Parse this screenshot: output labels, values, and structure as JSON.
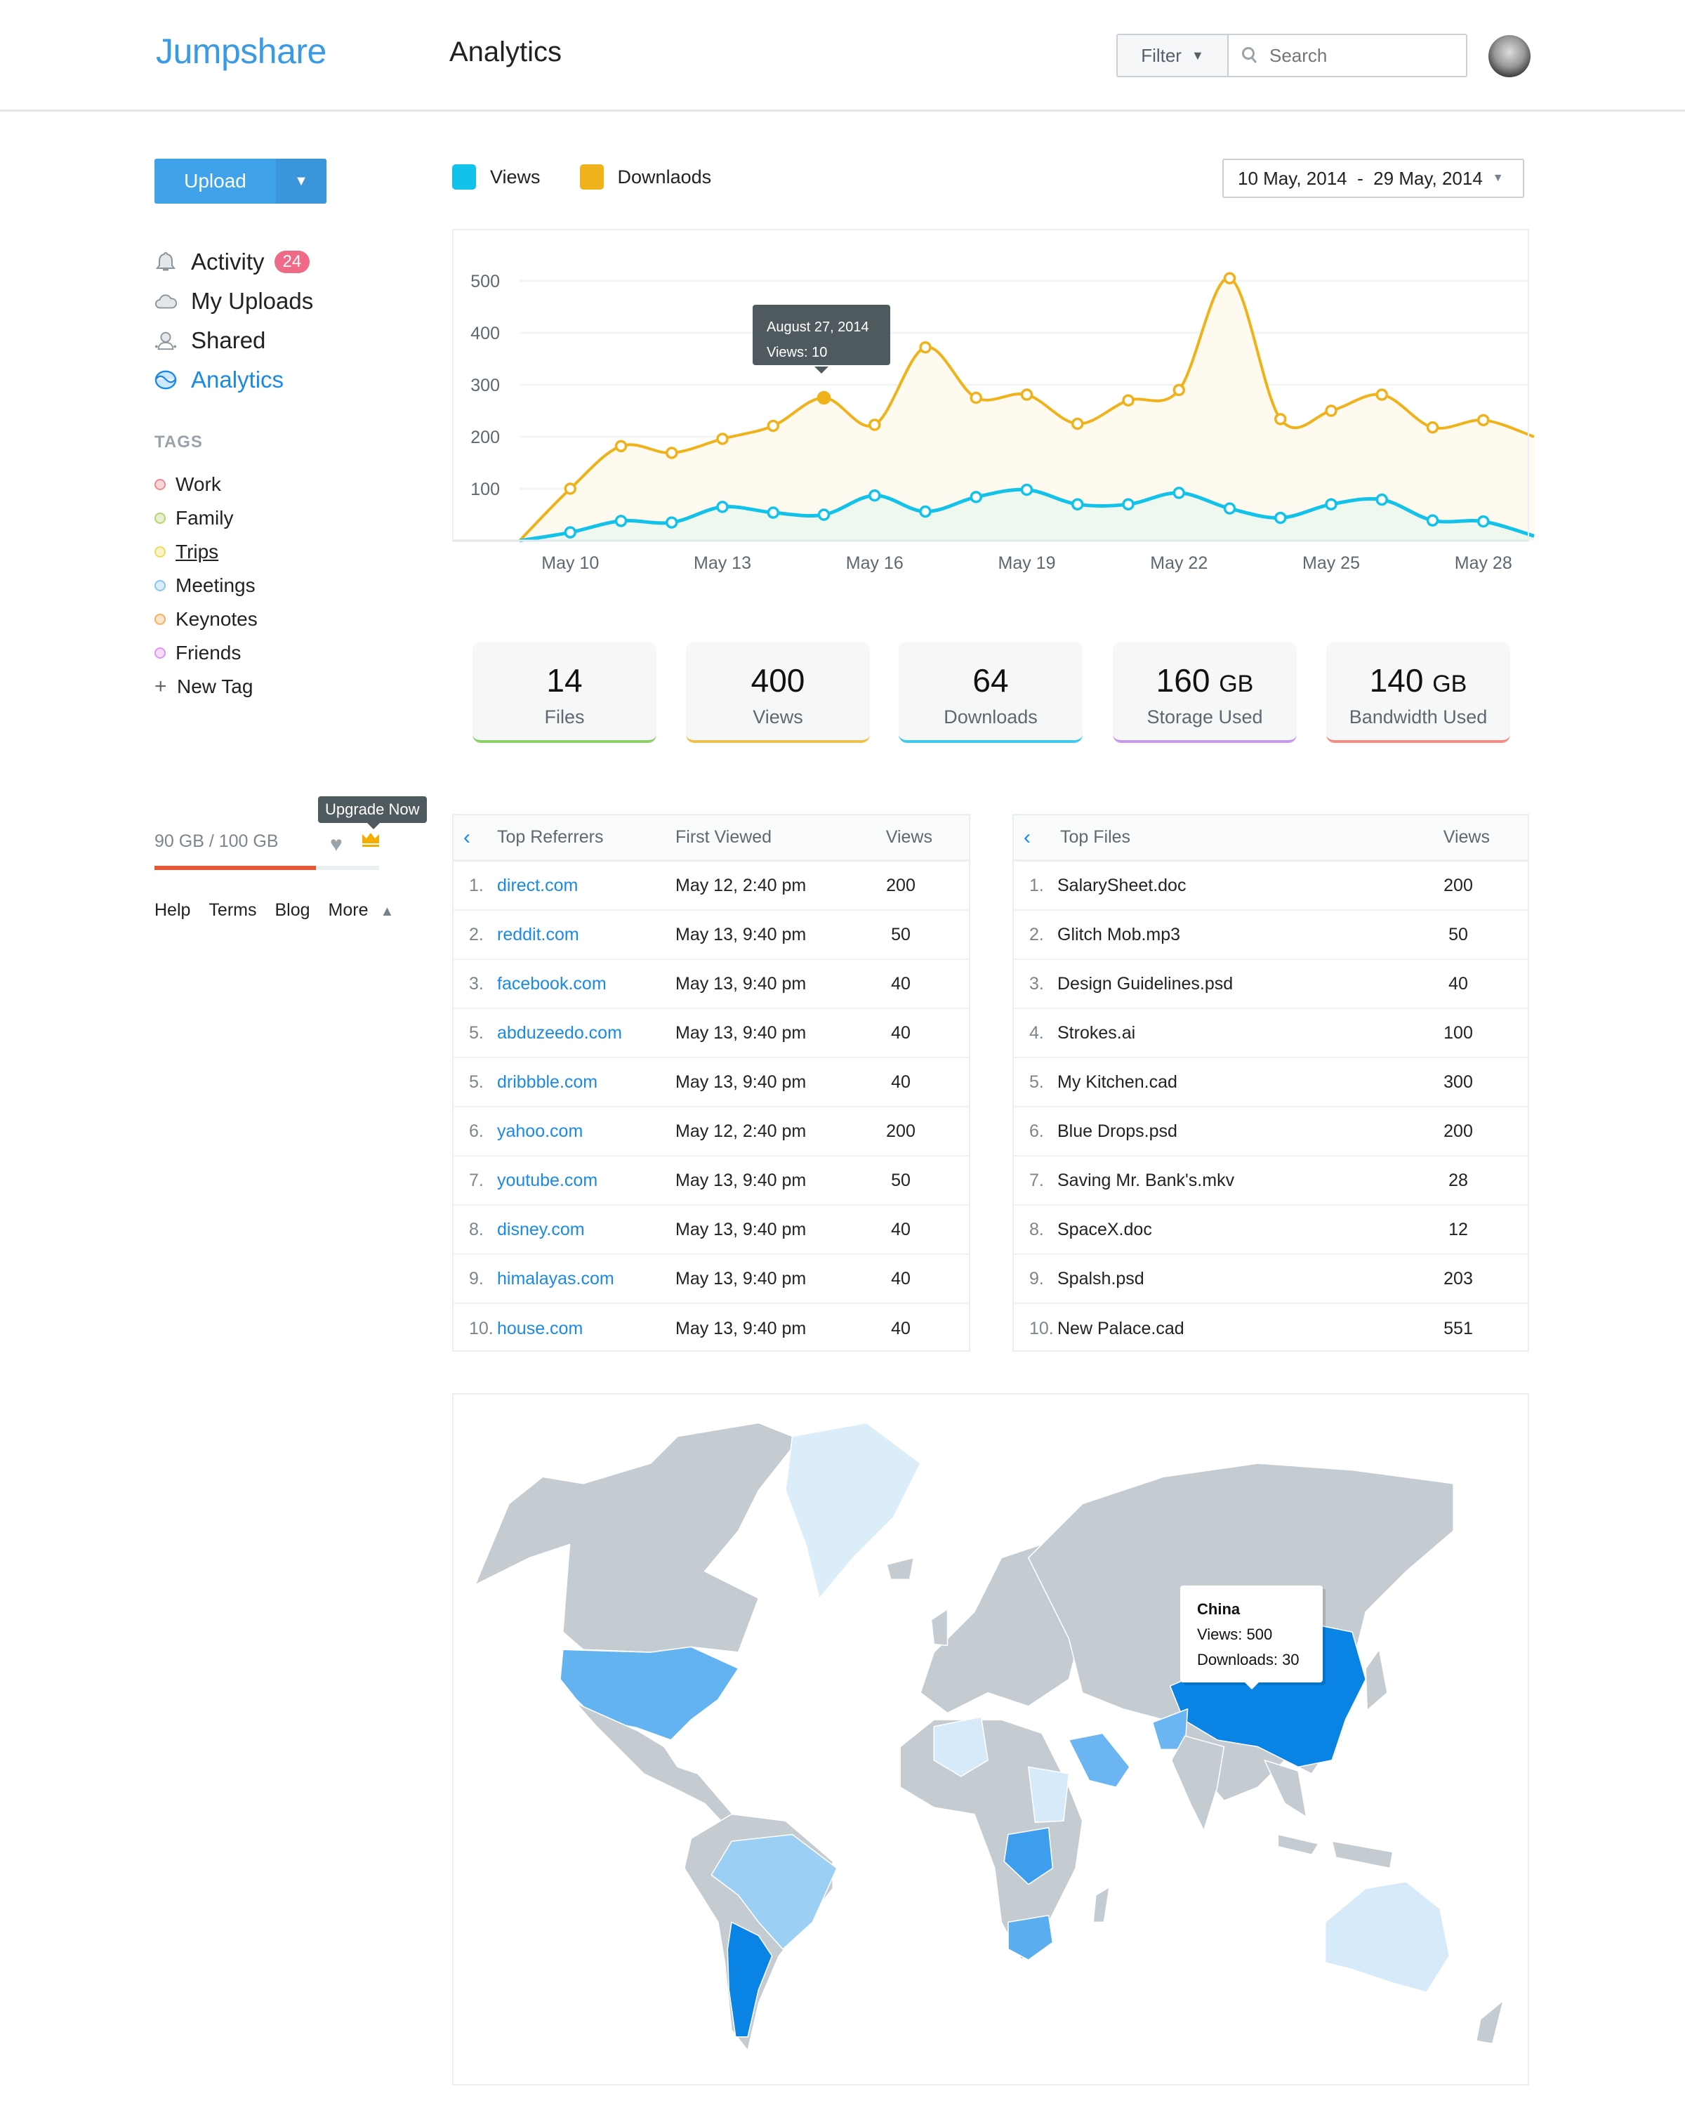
{
  "header": {
    "logo": "Jumpshare",
    "title": "Analytics",
    "filter_label": "Filter",
    "search_placeholder": "Search"
  },
  "sidebar": {
    "upload_label": "Upload",
    "nav": [
      {
        "label": "Activity",
        "icon": "bell-icon",
        "badge": "24"
      },
      {
        "label": "My Uploads",
        "icon": "cloud-icon"
      },
      {
        "label": "Shared",
        "icon": "user-icon"
      },
      {
        "label": "Analytics",
        "icon": "analytics-icon",
        "active": true
      }
    ],
    "tags_heading": "TAGS",
    "tags": [
      {
        "label": "Work",
        "color": "#ee8a93"
      },
      {
        "label": "Family",
        "color": "#b3d66e"
      },
      {
        "label": "Trips",
        "color": "#ecdc62"
      },
      {
        "label": "Meetings",
        "color": "#8ec5ec"
      },
      {
        "label": "Keynotes",
        "color": "#f2b061"
      },
      {
        "label": "Friends",
        "color": "#dc98ea"
      }
    ],
    "new_tag": "New Tag",
    "storage_text": "90 GB / 100 GB",
    "storage_used_fraction": 0.9,
    "upgrade_tooltip": "Upgrade Now",
    "footer": [
      "Help",
      "Terms",
      "Blog",
      "More"
    ]
  },
  "legend": {
    "views": "Views",
    "downloads": "Downlaods"
  },
  "date_range": "10 May, 2014  -  29 May, 2014",
  "chart_tooltip": {
    "title": "August 27, 2014",
    "value": "Views: 10"
  },
  "chart_data": {
    "type": "area",
    "x": [
      "May 9",
      "May 10",
      "May 11",
      "May 12",
      "May 13",
      "May 14",
      "May 15",
      "May 16",
      "May 17",
      "May 18",
      "May 19",
      "May 20",
      "May 21",
      "May 22",
      "May 23",
      "May 24",
      "May 25",
      "May 26",
      "May 27",
      "May 28",
      "May 29"
    ],
    "xtick_labels": [
      "May 10",
      "May 13",
      "May 16",
      "May 19",
      "May 22",
      "May 25",
      "May 28"
    ],
    "ytick_labels": [
      "100",
      "200",
      "300",
      "400",
      "500"
    ],
    "ylim": [
      0,
      500
    ],
    "grid": true,
    "series": [
      {
        "name": "Downlaods",
        "color": "#f0b21b",
        "fill": "#fefaf0",
        "values": [
          0,
          100,
          182,
          169,
          196,
          221,
          275,
          223,
          372,
          275,
          281,
          225,
          270,
          290,
          505,
          234,
          250,
          281,
          218,
          232,
          200
        ]
      },
      {
        "name": "Views",
        "color": "#12c2e9",
        "fill": "#eef8ef",
        "values": [
          0,
          16,
          38,
          35,
          65,
          54,
          50,
          87,
          56,
          84,
          98,
          70,
          70,
          92,
          62,
          44,
          70,
          79,
          39,
          37,
          9
        ]
      }
    ],
    "highlighted_point": {
      "series": "Downlaods",
      "x": "May 15"
    }
  },
  "stats": [
    {
      "value": "14",
      "unit": "",
      "label": "Files",
      "color": "#8fcf6a"
    },
    {
      "value": "400",
      "unit": "",
      "label": "Views",
      "color": "#f0c04e"
    },
    {
      "value": "64",
      "unit": "",
      "label": "Downloads",
      "color": "#3fcbe9"
    },
    {
      "value": "160",
      "unit": "GB",
      "label": "Storage Used",
      "color": "#c69be9"
    },
    {
      "value": "140",
      "unit": "GB",
      "label": "Bandwidth Used",
      "color": "#f08e86"
    }
  ],
  "referrers": {
    "headers": [
      "Top Referrers",
      "First Viewed",
      "Views"
    ],
    "rows": [
      [
        "1.",
        "direct.com",
        "May 12, 2:40 pm",
        "200"
      ],
      [
        "2.",
        "reddit.com",
        "May 13, 9:40 pm",
        "50"
      ],
      [
        "3.",
        "facebook.com",
        "May 13, 9:40 pm",
        "40"
      ],
      [
        "5.",
        "abduzeedo.com",
        "May 13, 9:40 pm",
        "40"
      ],
      [
        "5.",
        "dribbble.com",
        "May 13, 9:40 pm",
        "40"
      ],
      [
        "6.",
        "yahoo.com",
        "May 12, 2:40 pm",
        "200"
      ],
      [
        "7.",
        "youtube.com",
        "May 13, 9:40 pm",
        "50"
      ],
      [
        "8.",
        "disney.com",
        "May 13, 9:40 pm",
        "40"
      ],
      [
        "9.",
        "himalayas.com",
        "May 13, 9:40 pm",
        "40"
      ],
      [
        "10.",
        "house.com",
        "May 13, 9:40 pm",
        "40"
      ]
    ]
  },
  "files": {
    "headers": [
      "Top Files",
      "Views"
    ],
    "rows": [
      [
        "1.",
        "SalarySheet.doc",
        "200"
      ],
      [
        "2.",
        "Glitch Mob.mp3",
        "50"
      ],
      [
        "3.",
        "Design Guidelines.psd",
        "40"
      ],
      [
        "4.",
        "Strokes.ai",
        "100"
      ],
      [
        "5.",
        "My Kitchen.cad",
        "300"
      ],
      [
        "6.",
        "Blue Drops.psd",
        "200"
      ],
      [
        "7.",
        "Saving Mr. Bank's.mkv",
        "28"
      ],
      [
        "8.",
        "SpaceX.doc",
        "12"
      ],
      [
        "9.",
        "Spalsh.psd",
        "203"
      ],
      [
        "10.",
        "New Palace.cad",
        "551"
      ]
    ]
  },
  "map": {
    "tooltip": {
      "country": "China",
      "views": "Views: 500",
      "downloads": "Downloads: 30"
    },
    "base_color": "#c4cbd1",
    "highlight_colors": [
      "#0a84e4",
      "#5aaef0",
      "#9ccff4",
      "#d6eafa"
    ]
  }
}
